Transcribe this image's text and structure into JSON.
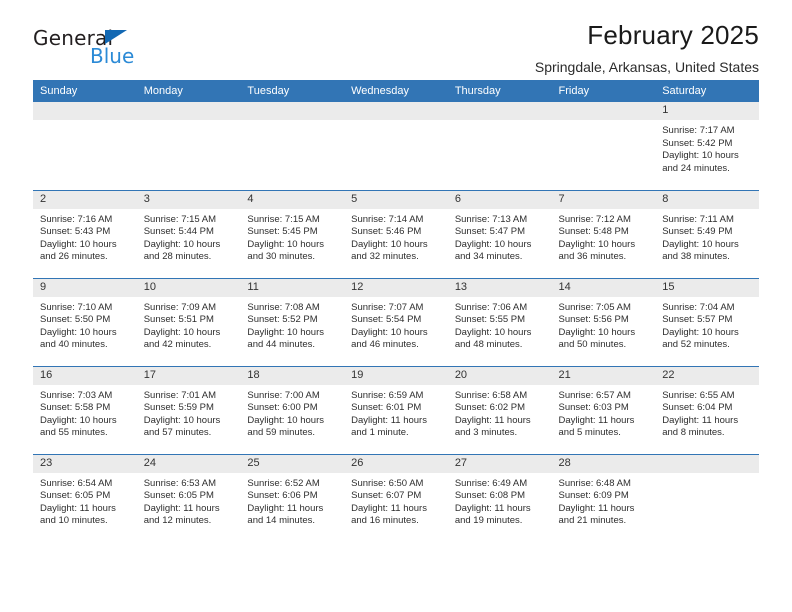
{
  "brand": {
    "word_one": "General",
    "word_two": "Blue",
    "triangle_icon": "triangle-icon",
    "accent_dark_blue": "#1268b3",
    "accent_light_blue": "#2b8ad6"
  },
  "header": {
    "title": "February 2025",
    "subtitle": "Springdale, Arkansas, United States"
  },
  "calendar": {
    "header_background": "#3275b5",
    "daynum_background": "#ebebeb",
    "weekdays": [
      "Sunday",
      "Monday",
      "Tuesday",
      "Wednesday",
      "Thursday",
      "Friday",
      "Saturday"
    ],
    "labels": {
      "sunrise": "Sunrise:",
      "sunset": "Sunset:",
      "daylight": "Daylight:"
    },
    "weeks": [
      [
        {
          "day": "",
          "empty": true
        },
        {
          "day": "",
          "empty": true
        },
        {
          "day": "",
          "empty": true
        },
        {
          "day": "",
          "empty": true
        },
        {
          "day": "",
          "empty": true
        },
        {
          "day": "",
          "empty": true
        },
        {
          "day": "1",
          "sunrise": "Sunrise: 7:17 AM",
          "sunset": "Sunset: 5:42 PM",
          "daylight": "Daylight: 10 hours and 24 minutes."
        }
      ],
      [
        {
          "day": "2",
          "sunrise": "Sunrise: 7:16 AM",
          "sunset": "Sunset: 5:43 PM",
          "daylight": "Daylight: 10 hours and 26 minutes."
        },
        {
          "day": "3",
          "sunrise": "Sunrise: 7:15 AM",
          "sunset": "Sunset: 5:44 PM",
          "daylight": "Daylight: 10 hours and 28 minutes."
        },
        {
          "day": "4",
          "sunrise": "Sunrise: 7:15 AM",
          "sunset": "Sunset: 5:45 PM",
          "daylight": "Daylight: 10 hours and 30 minutes."
        },
        {
          "day": "5",
          "sunrise": "Sunrise: 7:14 AM",
          "sunset": "Sunset: 5:46 PM",
          "daylight": "Daylight: 10 hours and 32 minutes."
        },
        {
          "day": "6",
          "sunrise": "Sunrise: 7:13 AM",
          "sunset": "Sunset: 5:47 PM",
          "daylight": "Daylight: 10 hours and 34 minutes."
        },
        {
          "day": "7",
          "sunrise": "Sunrise: 7:12 AM",
          "sunset": "Sunset: 5:48 PM",
          "daylight": "Daylight: 10 hours and 36 minutes."
        },
        {
          "day": "8",
          "sunrise": "Sunrise: 7:11 AM",
          "sunset": "Sunset: 5:49 PM",
          "daylight": "Daylight: 10 hours and 38 minutes."
        }
      ],
      [
        {
          "day": "9",
          "sunrise": "Sunrise: 7:10 AM",
          "sunset": "Sunset: 5:50 PM",
          "daylight": "Daylight: 10 hours and 40 minutes."
        },
        {
          "day": "10",
          "sunrise": "Sunrise: 7:09 AM",
          "sunset": "Sunset: 5:51 PM",
          "daylight": "Daylight: 10 hours and 42 minutes."
        },
        {
          "day": "11",
          "sunrise": "Sunrise: 7:08 AM",
          "sunset": "Sunset: 5:52 PM",
          "daylight": "Daylight: 10 hours and 44 minutes."
        },
        {
          "day": "12",
          "sunrise": "Sunrise: 7:07 AM",
          "sunset": "Sunset: 5:54 PM",
          "daylight": "Daylight: 10 hours and 46 minutes."
        },
        {
          "day": "13",
          "sunrise": "Sunrise: 7:06 AM",
          "sunset": "Sunset: 5:55 PM",
          "daylight": "Daylight: 10 hours and 48 minutes."
        },
        {
          "day": "14",
          "sunrise": "Sunrise: 7:05 AM",
          "sunset": "Sunset: 5:56 PM",
          "daylight": "Daylight: 10 hours and 50 minutes."
        },
        {
          "day": "15",
          "sunrise": "Sunrise: 7:04 AM",
          "sunset": "Sunset: 5:57 PM",
          "daylight": "Daylight: 10 hours and 52 minutes."
        }
      ],
      [
        {
          "day": "16",
          "sunrise": "Sunrise: 7:03 AM",
          "sunset": "Sunset: 5:58 PM",
          "daylight": "Daylight: 10 hours and 55 minutes."
        },
        {
          "day": "17",
          "sunrise": "Sunrise: 7:01 AM",
          "sunset": "Sunset: 5:59 PM",
          "daylight": "Daylight: 10 hours and 57 minutes."
        },
        {
          "day": "18",
          "sunrise": "Sunrise: 7:00 AM",
          "sunset": "Sunset: 6:00 PM",
          "daylight": "Daylight: 10 hours and 59 minutes."
        },
        {
          "day": "19",
          "sunrise": "Sunrise: 6:59 AM",
          "sunset": "Sunset: 6:01 PM",
          "daylight": "Daylight: 11 hours and 1 minute."
        },
        {
          "day": "20",
          "sunrise": "Sunrise: 6:58 AM",
          "sunset": "Sunset: 6:02 PM",
          "daylight": "Daylight: 11 hours and 3 minutes."
        },
        {
          "day": "21",
          "sunrise": "Sunrise: 6:57 AM",
          "sunset": "Sunset: 6:03 PM",
          "daylight": "Daylight: 11 hours and 5 minutes."
        },
        {
          "day": "22",
          "sunrise": "Sunrise: 6:55 AM",
          "sunset": "Sunset: 6:04 PM",
          "daylight": "Daylight: 11 hours and 8 minutes."
        }
      ],
      [
        {
          "day": "23",
          "sunrise": "Sunrise: 6:54 AM",
          "sunset": "Sunset: 6:05 PM",
          "daylight": "Daylight: 11 hours and 10 minutes."
        },
        {
          "day": "24",
          "sunrise": "Sunrise: 6:53 AM",
          "sunset": "Sunset: 6:05 PM",
          "daylight": "Daylight: 11 hours and 12 minutes."
        },
        {
          "day": "25",
          "sunrise": "Sunrise: 6:52 AM",
          "sunset": "Sunset: 6:06 PM",
          "daylight": "Daylight: 11 hours and 14 minutes."
        },
        {
          "day": "26",
          "sunrise": "Sunrise: 6:50 AM",
          "sunset": "Sunset: 6:07 PM",
          "daylight": "Daylight: 11 hours and 16 minutes."
        },
        {
          "day": "27",
          "sunrise": "Sunrise: 6:49 AM",
          "sunset": "Sunset: 6:08 PM",
          "daylight": "Daylight: 11 hours and 19 minutes."
        },
        {
          "day": "28",
          "sunrise": "Sunrise: 6:48 AM",
          "sunset": "Sunset: 6:09 PM",
          "daylight": "Daylight: 11 hours and 21 minutes."
        },
        {
          "day": "",
          "empty": true
        }
      ]
    ]
  }
}
